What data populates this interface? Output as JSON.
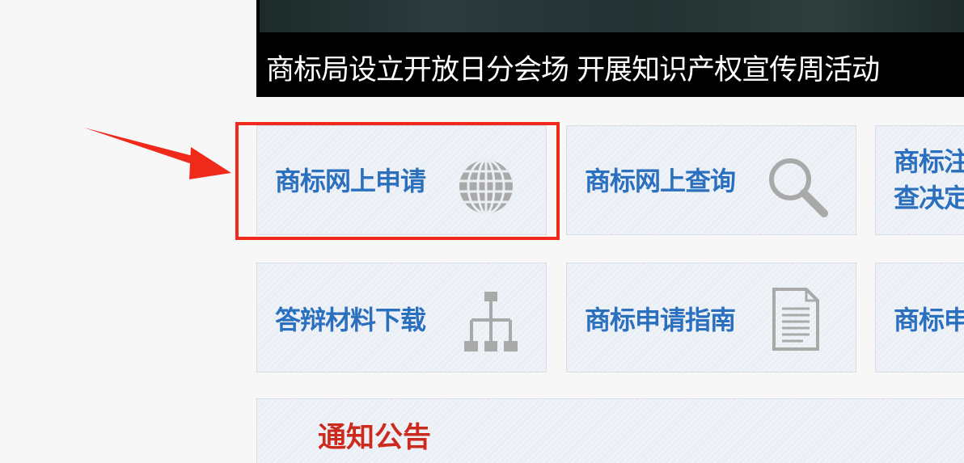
{
  "banner": {
    "caption": "商标局设立开放日分会场 开展知识产权宣传周活动"
  },
  "tiles": [
    {
      "label": "商标网上申请",
      "icon": "globe-icon"
    },
    {
      "label": "商标网上查询",
      "icon": "magnifier-icon"
    },
    {
      "label": "商标注册审查决定",
      "visible_text_lines": [
        "商标注",
        "查决定"
      ],
      "icon": ""
    },
    {
      "label": "答辩材料下载",
      "icon": "sitemap-icon"
    },
    {
      "label": "商标申请指南",
      "icon": "document-icon"
    },
    {
      "label": "商标申",
      "icon": ""
    }
  ],
  "tile_texts": {
    "t3_line1": "商标注",
    "t3_line2": "查决定"
  },
  "notice": {
    "title": "通知公告"
  },
  "colors": {
    "tile_text": "#2b6fbf",
    "highlight": "#ef2a1b",
    "notice_title": "#cc2a1c",
    "icon_gray": "#a9a9a9"
  }
}
